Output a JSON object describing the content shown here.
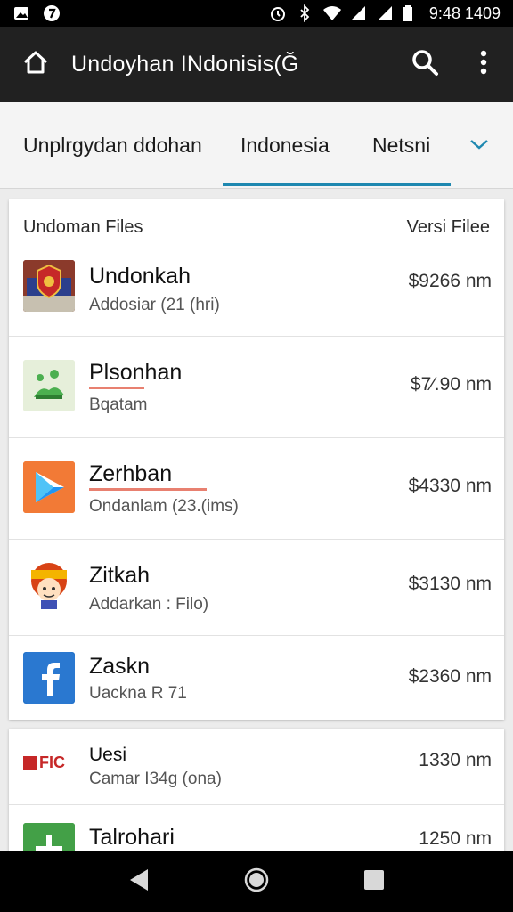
{
  "status_bar": {
    "time": "9:48 1409"
  },
  "app_bar": {
    "title": "Undoyhan  INdonisis(Ğ"
  },
  "tabs": [
    {
      "label": "Unplrgydan ddohan"
    },
    {
      "label": "Indonesia"
    },
    {
      "label": "Netsni"
    }
  ],
  "list": {
    "header_left": "Undoman Files",
    "header_right": "Versi  Filee",
    "items": [
      {
        "title": "Undonkah",
        "subtitle": "Addosiar (21 (hri)",
        "price": "$9266 nm"
      },
      {
        "title": "Plsonhan",
        "subtitle": "Bqatam",
        "price": "$7⁄.90 nm"
      },
      {
        "title": "Zerhban",
        "subtitle": "Ondanlam (23.(ims)",
        "price": "$4330 nm"
      },
      {
        "title": "Zitkah",
        "subtitle": "Addarkan : Filo)",
        "price": "$3130 nm"
      },
      {
        "title": "Zaskn",
        "subtitle": "Uackna R 71",
        "price": "$2360 nm"
      }
    ]
  },
  "list2": {
    "items": [
      {
        "logo_text": "FIC",
        "title": "Uesi",
        "subtitle": "Camar I34g (ona)",
        "price": "1330 nm"
      },
      {
        "title": "Talrohari",
        "price": "1250 nm"
      }
    ]
  },
  "colors": {
    "accent": "#1e88b0",
    "app_bar": "#212121",
    "highlight": "#e88070"
  }
}
